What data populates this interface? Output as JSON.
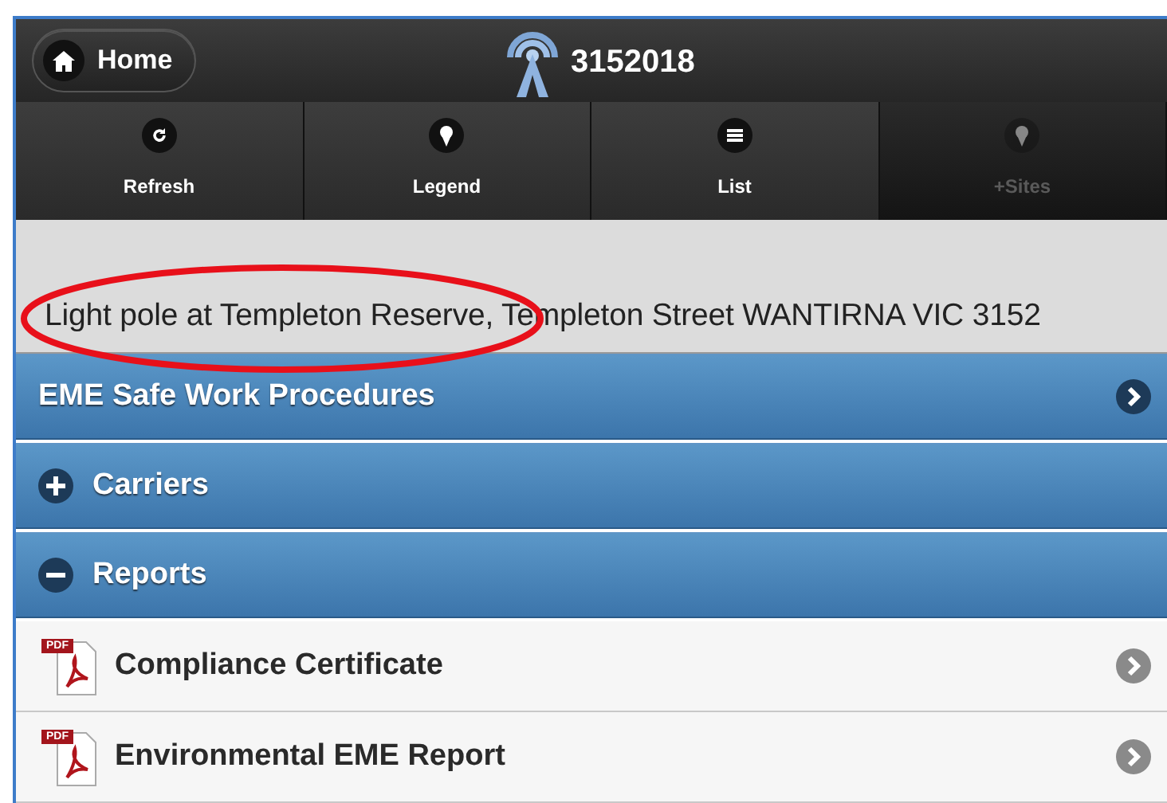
{
  "header": {
    "home_button": "Home",
    "title": "3152018"
  },
  "toolbar": [
    {
      "label": "Refresh",
      "disabled": false
    },
    {
      "label": "Legend",
      "disabled": false
    },
    {
      "label": "List",
      "disabled": false
    },
    {
      "label": "+Sites",
      "disabled": true
    }
  ],
  "address": {
    "text": "Light pole at Templeton Reserve, Templeton Street WANTIRNA VIC 3152",
    "circled": true
  },
  "sections": [
    {
      "kind": "link",
      "label": "EME Safe Work Procedures"
    },
    {
      "kind": "collapsible",
      "label": "Carriers",
      "expanded": false
    },
    {
      "kind": "collapsible",
      "label": "Reports",
      "expanded": true
    }
  ],
  "reports": [
    {
      "badge": "PDF",
      "label": "Compliance Certificate"
    },
    {
      "badge": "PDF",
      "label": "Environmental EME Report"
    }
  ]
}
